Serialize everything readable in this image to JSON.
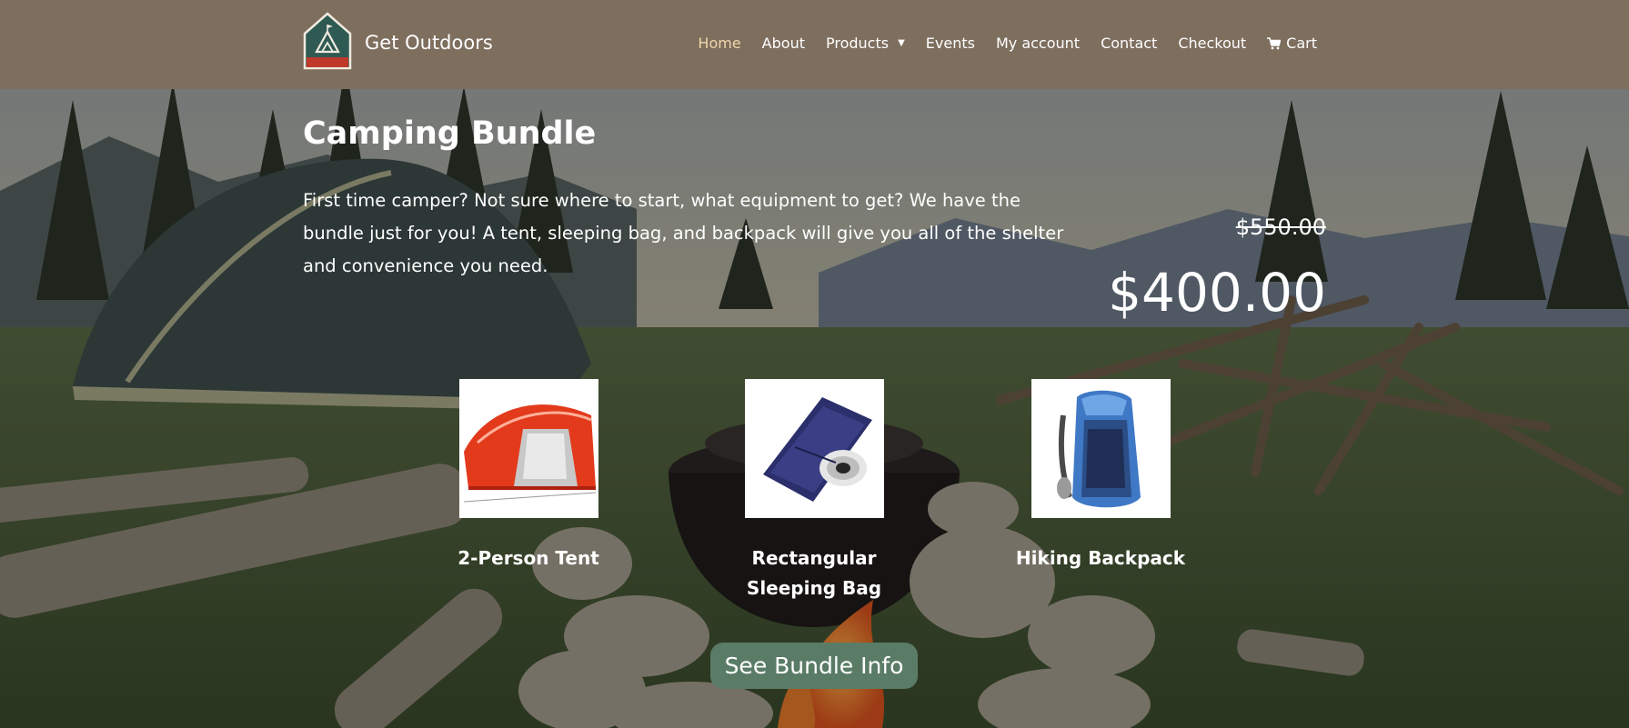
{
  "header": {
    "logo_text": "GET OUTDOORS",
    "site_title": "Get Outdoors",
    "nav": [
      {
        "label": "Home",
        "active": true
      },
      {
        "label": "About"
      },
      {
        "label": "Products",
        "has_dropdown": true
      },
      {
        "label": "Events"
      },
      {
        "label": "My account"
      },
      {
        "label": "Contact"
      },
      {
        "label": "Checkout"
      },
      {
        "label": "Cart",
        "icon": "cart-icon"
      }
    ]
  },
  "hero": {
    "title": "Camping Bundle",
    "description": "First time camper? Not sure where to start, what equipment to get? We have the bundle just for you! A tent, sleeping bag, and backpack will give you all of the shelter and convenience you need.",
    "old_price": "$550.00",
    "price": "$400.00"
  },
  "products": [
    {
      "name": "2-Person Tent",
      "image": "red-tent-image"
    },
    {
      "name": "Rectangular Sleeping Bag",
      "image": "sleeping-bag-image"
    },
    {
      "name": "Hiking Backpack",
      "image": "blue-backpack-image"
    }
  ],
  "cta": {
    "label": "See Bundle Info"
  },
  "colors": {
    "header_bg": "#7e6e5e",
    "active_nav": "#f1d6a9",
    "button_bg": "#5a7c67",
    "logo_bg": "#2f5a54",
    "logo_red": "#c0392b"
  }
}
